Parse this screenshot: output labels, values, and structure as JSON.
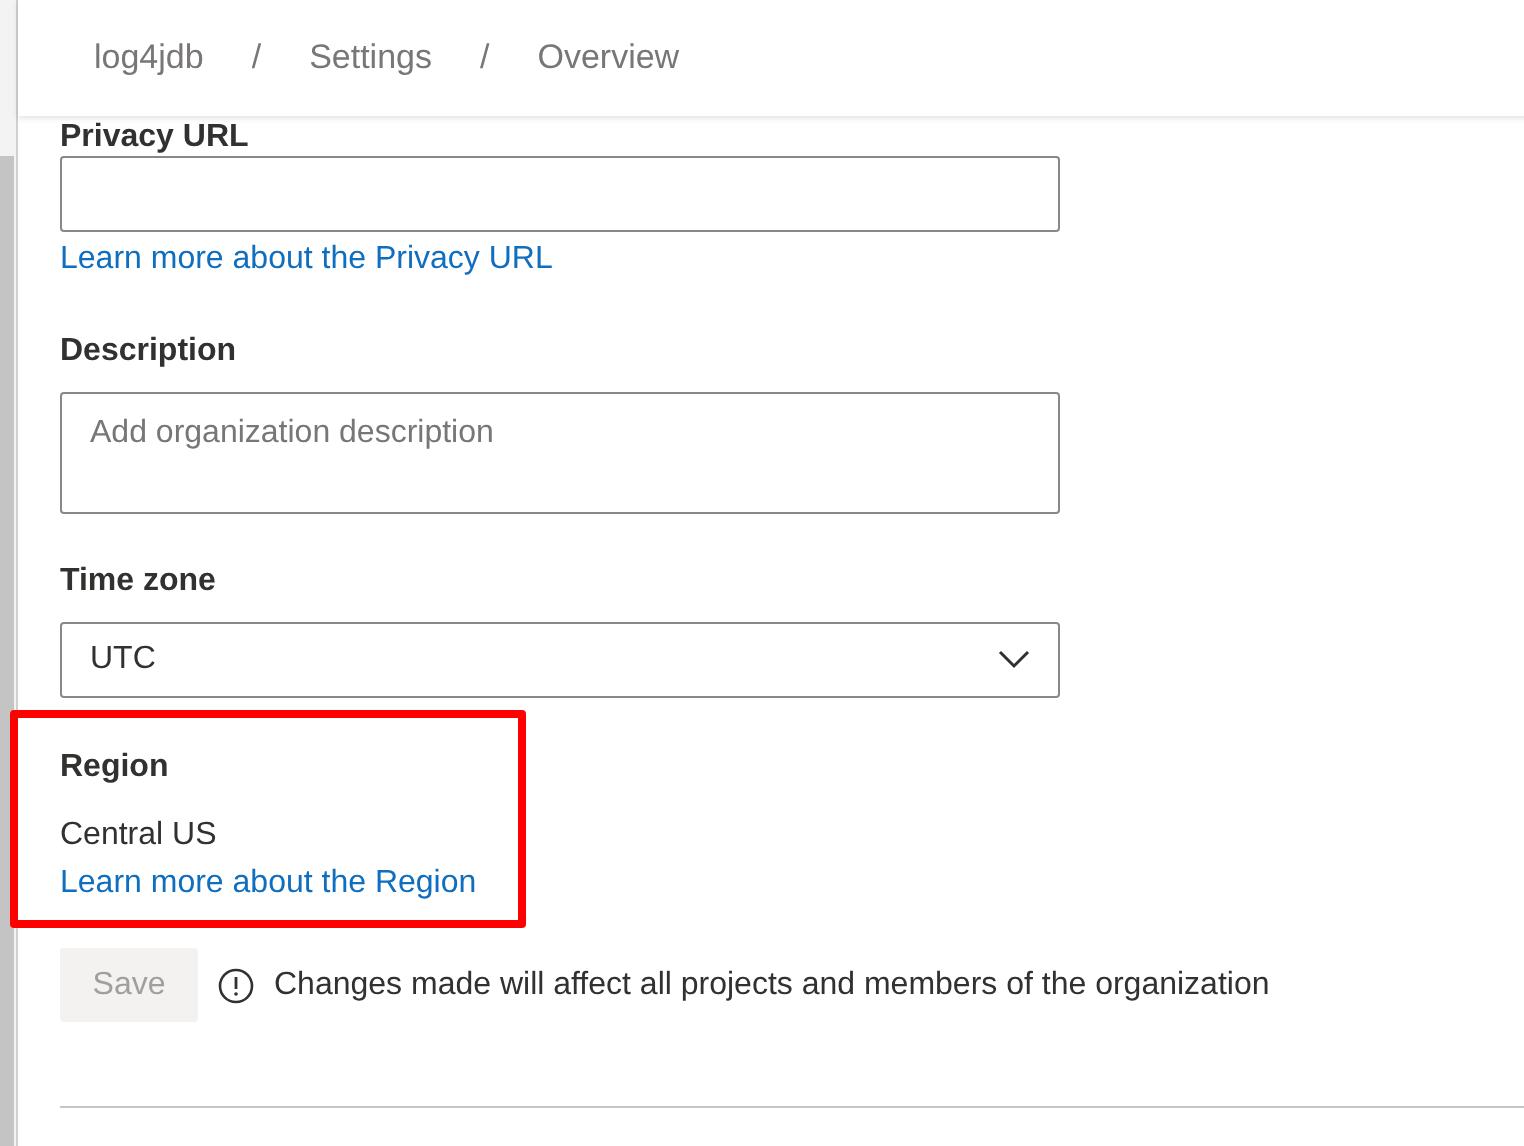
{
  "breadcrumb": [
    {
      "label": "log4jdb"
    },
    {
      "separator": "/",
      "label": "Settings"
    },
    {
      "separator": "/",
      "label": "Overview"
    }
  ],
  "privacy_url": {
    "label": "Privacy URL",
    "link": "Learn more about the Privacy URL"
  },
  "description": {
    "label": "Description",
    "placeholder": "Add organization description"
  },
  "time_zone": {
    "label": "Time zone",
    "value": "UTC"
  },
  "region": {
    "label": "Region",
    "value": "Central US",
    "link": "Learn more about the Region"
  },
  "save_button": {
    "label": "Save",
    "disabled": true
  },
  "notice": "Changes made will affect all projects and members of the organization"
}
